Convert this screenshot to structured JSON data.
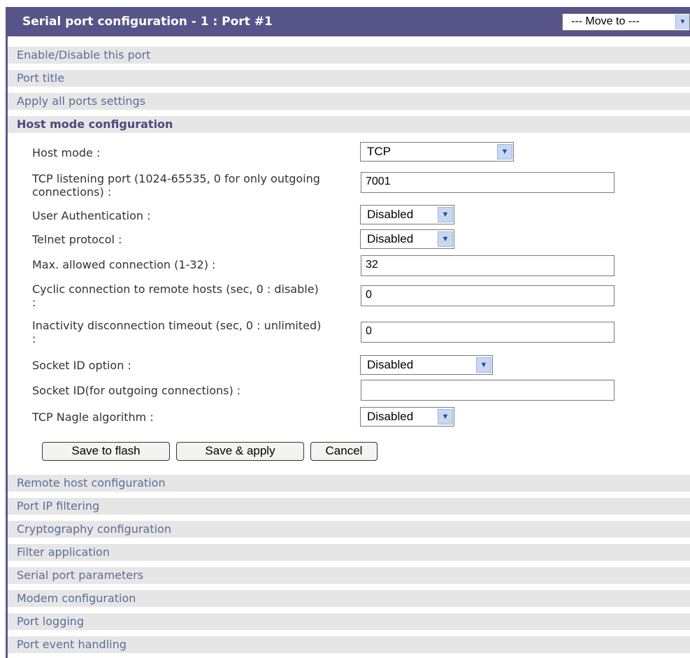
{
  "header": {
    "title": "Serial port configuration - 1 : Port #1",
    "move_to": "--- Move to ---"
  },
  "sections_top": [
    "Enable/Disable this port",
    "Port title",
    "Apply all ports settings",
    "Host mode configuration"
  ],
  "form": {
    "host_mode": {
      "label": "Host mode :",
      "value": "TCP"
    },
    "tcp_listening_port": {
      "label": "TCP listening port (1024-65535, 0 for only outgoing connections) :",
      "value": "7001"
    },
    "user_auth": {
      "label": "User Authentication :",
      "value": "Disabled"
    },
    "telnet": {
      "label": "Telnet protocol :",
      "value": "Disabled"
    },
    "max_conn": {
      "label": "Max. allowed connection (1-32) :",
      "value": "32"
    },
    "cyclic": {
      "label": "Cyclic connection to remote hosts (sec, 0 : disable) :",
      "value": "0"
    },
    "inactivity": {
      "label": "Inactivity disconnection timeout (sec, 0 : unlimited) :",
      "value": "0"
    },
    "socket_id_option": {
      "label": "Socket ID option :",
      "value": "Disabled"
    },
    "socket_id": {
      "label": "Socket ID(for outgoing connections) :",
      "value": ""
    },
    "nagle": {
      "label": "TCP Nagle algorithm :",
      "value": "Disabled"
    }
  },
  "buttons": {
    "save_flash": "Save to flash",
    "save_apply": "Save & apply",
    "cancel": "Cancel"
  },
  "sections_bottom": [
    "Remote host configuration",
    "Port IP filtering",
    "Cryptography configuration",
    "Filter application",
    "Serial port parameters",
    "Modem configuration",
    "Port logging",
    "Port event handling"
  ],
  "icons": {
    "dropdown": "chevron-down-icon"
  },
  "colors": {
    "header_bg": "#565489",
    "section_bg": "#e6e6e6",
    "section_text": "#5c6c9a",
    "active_text": "#4a4a7e"
  }
}
